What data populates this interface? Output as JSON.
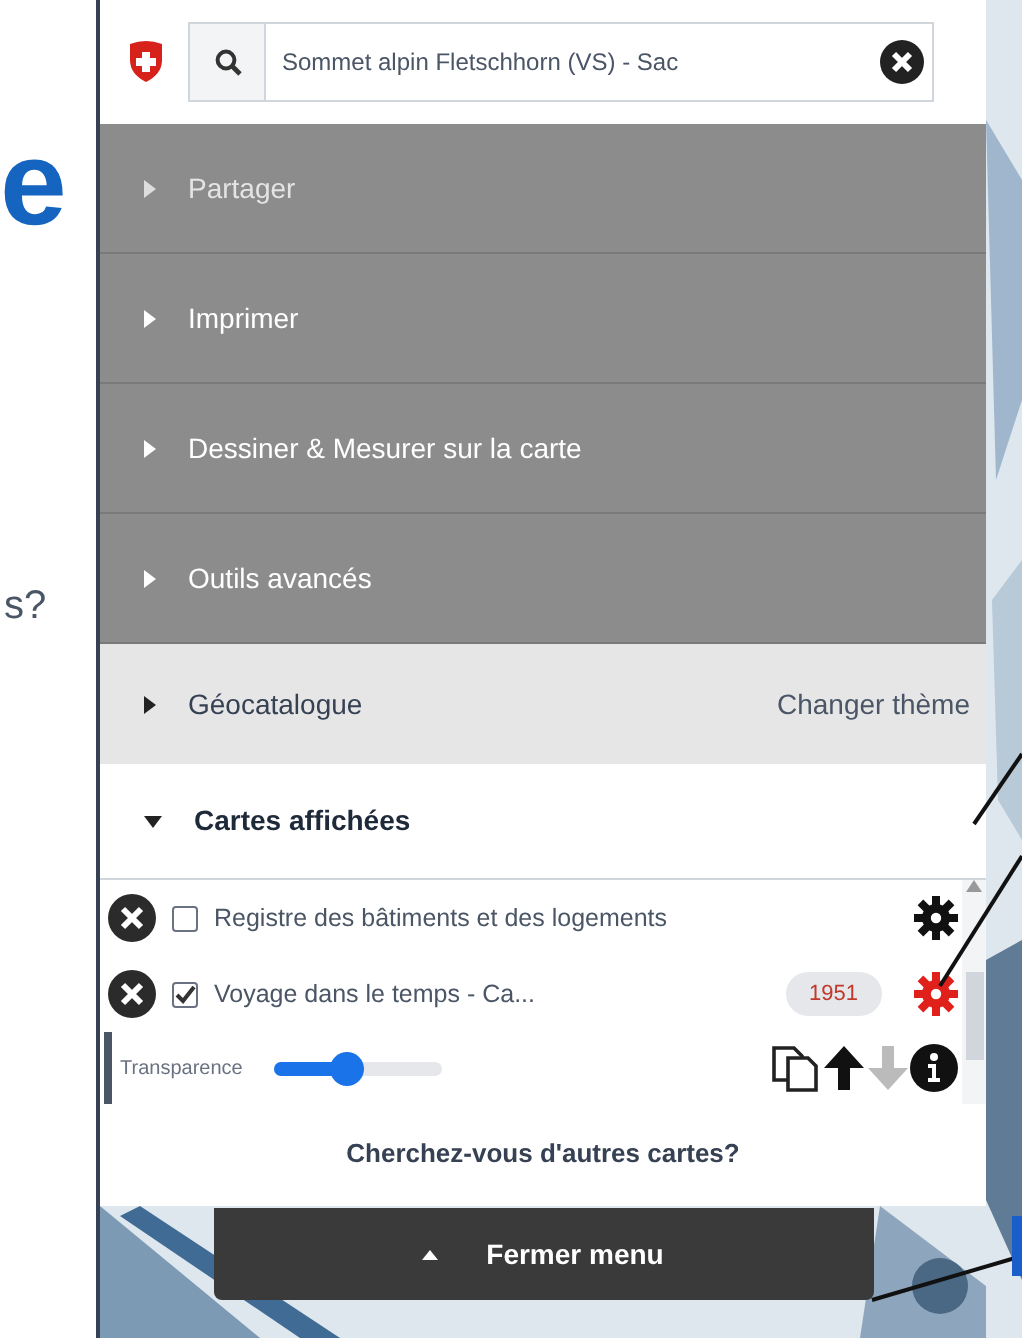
{
  "left_text": {
    "heading_fragment": "e",
    "question_fragment": "s?"
  },
  "search": {
    "value": "Sommet alpin Fletschhorn (VS) - Sac"
  },
  "sections": [
    {
      "label": "Partager",
      "expanded": false,
      "dimmed": true
    },
    {
      "label": "Imprimer",
      "expanded": false,
      "dimmed": false
    },
    {
      "label": "Dessiner & Mesurer sur la carte",
      "expanded": false,
      "dimmed": false
    },
    {
      "label": "Outils avancés",
      "expanded": false,
      "dimmed": false
    }
  ],
  "catalog": {
    "label": "Géocatalogue",
    "expanded": false,
    "action": "Changer thème"
  },
  "displayed": {
    "label": "Cartes affichées",
    "expanded": true
  },
  "layers": [
    {
      "name": "Registre des bâtiments et des logements",
      "checked": false,
      "settings_active": false
    },
    {
      "name": "Voyage dans le temps - Ca...",
      "checked": true,
      "year": "1951",
      "settings_active": true
    }
  ],
  "transparency": {
    "label": "Transparence",
    "level": 0.42
  },
  "more_maps": "Cherchez-vous d'autres cartes?",
  "close_menu": "Fermer menu"
}
